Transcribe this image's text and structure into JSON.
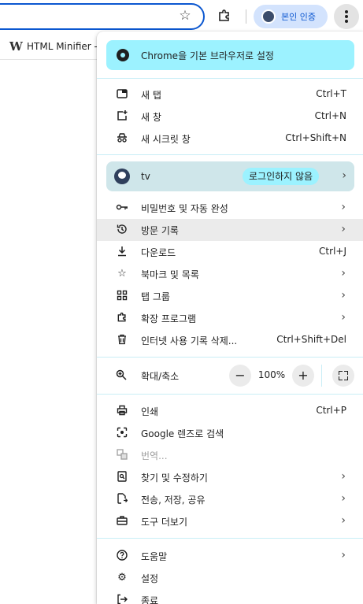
{
  "toolbar": {
    "profile_label": "본인 인증"
  },
  "bookmarks": {
    "item_label": "HTML Minifier -",
    "item_favicon": "W"
  },
  "menu": {
    "banner": {
      "label": "Chrome을 기본 브라우저로 설정",
      "icon": "chrome-icon"
    },
    "group1": [
      {
        "label": "새 탭",
        "shortcut": "Ctrl+T",
        "icon": "new-tab-icon"
      },
      {
        "label": "새 창",
        "shortcut": "Ctrl+N",
        "icon": "new-window-icon"
      },
      {
        "label": "새 시크릿 창",
        "shortcut": "Ctrl+Shift+N",
        "icon": "incognito-icon"
      }
    ],
    "profile": {
      "name": "tv",
      "badge": "로그인하지 않음"
    },
    "group2": [
      {
        "label": "비밀번호 및 자동 완성",
        "shortcut": "",
        "icon": "key-icon",
        "submenu": true
      },
      {
        "label": "방문 기록",
        "shortcut": "",
        "icon": "history-icon",
        "submenu": true
      },
      {
        "label": "다운로드",
        "shortcut": "Ctrl+J",
        "icon": "download-icon",
        "submenu": false
      },
      {
        "label": "북마크 및 목록",
        "shortcut": "",
        "icon": "star-icon",
        "submenu": true
      },
      {
        "label": "탭 그룹",
        "shortcut": "",
        "icon": "tab-groups-icon",
        "submenu": true
      },
      {
        "label": "확장 프로그램",
        "shortcut": "",
        "icon": "extension-icon",
        "submenu": true
      },
      {
        "label": "인터넷 사용 기록 삭제...",
        "shortcut": "Ctrl+Shift+Del",
        "icon": "trash-icon",
        "submenu": false
      }
    ],
    "zoom": {
      "label": "확대/축소",
      "value": "100%",
      "minus": "−",
      "plus": "+"
    },
    "group3": [
      {
        "label": "인쇄",
        "shortcut": "Ctrl+P",
        "icon": "print-icon",
        "submenu": false
      },
      {
        "label": "Google 렌즈로 검색",
        "shortcut": "",
        "icon": "lens-icon",
        "submenu": false
      },
      {
        "label": "번역...",
        "shortcut": "",
        "icon": "translate-icon",
        "submenu": false,
        "disabled": true
      },
      {
        "label": "찾기 및 수정하기",
        "shortcut": "",
        "icon": "find-icon",
        "submenu": true
      },
      {
        "label": "전송, 저장, 공유",
        "shortcut": "",
        "icon": "share-icon",
        "submenu": true
      },
      {
        "label": "도구 더보기",
        "shortcut": "",
        "icon": "toolbox-icon",
        "submenu": true
      }
    ],
    "group4": [
      {
        "label": "도움말",
        "shortcut": "",
        "icon": "help-icon",
        "submenu": true
      },
      {
        "label": "설정",
        "shortcut": "",
        "icon": "settings-icon",
        "submenu": false
      },
      {
        "label": "종료",
        "shortcut": "",
        "icon": "exit-icon",
        "submenu": false
      }
    ]
  },
  "colors": {
    "accent": "#0b57d0",
    "banner": "#9cf2ff",
    "profile_row": "#cfe6ea",
    "hover": "#ebebeb"
  }
}
